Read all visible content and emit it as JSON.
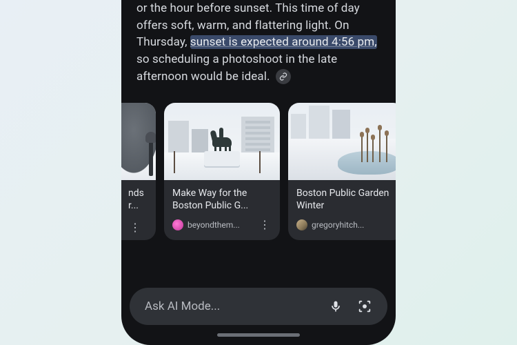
{
  "response": {
    "line1": "or the hour before sunset. This time of day",
    "line2": "offers soft, warm, and flattering light. On",
    "line3a": "Thursday, ",
    "highlight": "sunset is expected around 4:56 pm,",
    "line4": "so scheduling a photoshoot in the late",
    "line5": "afternoon would be ideal."
  },
  "cards": [
    {
      "title_frag_1": "nds",
      "title_frag_2": "r..."
    },
    {
      "title": "Make Way for the Boston Public G...",
      "source": "beyondthem..."
    },
    {
      "title": "Boston Public Garden Winter",
      "source": "gregoryhitch..."
    }
  ],
  "search": {
    "placeholder": "Ask AI Mode..."
  },
  "icons": {
    "link": "link-icon",
    "kebab": "⋮",
    "mic": "mic-icon",
    "lens": "lens-icon"
  }
}
